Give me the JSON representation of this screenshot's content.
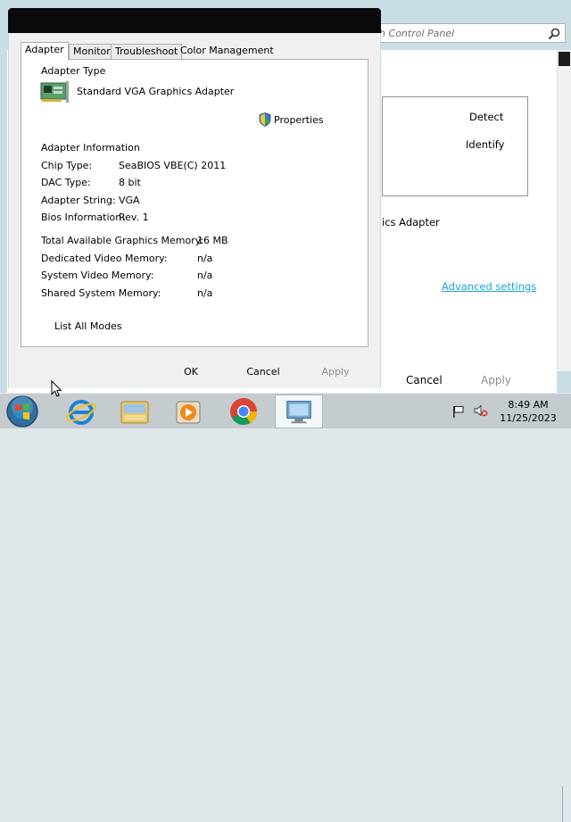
{
  "background_window": {
    "search_placeholder": "ch Control Panel",
    "detect_label": "Detect",
    "identify_label": "Identify",
    "adapter_text": "ics Adapter",
    "advanced_settings_link": "Advanced settings",
    "cancel_label": "Cancel",
    "apply_label": "Apply"
  },
  "dialog": {
    "tabs": [
      {
        "label": "Adapter",
        "active": true
      },
      {
        "label": "Monitor"
      },
      {
        "label": "Troubleshoot"
      },
      {
        "label": "Color Management"
      }
    ],
    "adapter_type_heading": "Adapter Type",
    "adapter_name": "Standard VGA Graphics Adapter",
    "properties_label": "Properties",
    "adapter_info_heading": "Adapter Information",
    "info": [
      {
        "label": "Chip Type:",
        "value": "SeaBIOS VBE(C) 2011"
      },
      {
        "label": "DAC Type:",
        "value": "8 bit"
      },
      {
        "label": "Adapter String:",
        "value": "VGA"
      },
      {
        "label": "Bios Information:",
        "value": "Rev. 1"
      }
    ],
    "memory": [
      {
        "label": "Total Available Graphics Memory:",
        "value": "16 MB"
      },
      {
        "label": "Dedicated Video Memory:",
        "value": "n/a"
      },
      {
        "label": "System Video Memory:",
        "value": "n/a"
      },
      {
        "label": "Shared System Memory:",
        "value": "n/a"
      }
    ],
    "list_all_modes_label": "List All Modes",
    "ok_label": "OK",
    "cancel_label": "Cancel",
    "apply_label": "Apply"
  },
  "taskbar": {
    "pinned": [
      "start-orb-icon",
      "internet-explorer-icon",
      "file-explorer-icon",
      "media-player-icon",
      "chrome-icon",
      "display-settings-icon"
    ],
    "clock_time": "8:49 AM",
    "clock_date": "11/25/2023"
  },
  "colors": {
    "accent_link": "#1aa3d9",
    "titlebar": "#0a0a0a",
    "taskbar": "#c4ccd0",
    "disabled_text": "#8d8d8d"
  }
}
